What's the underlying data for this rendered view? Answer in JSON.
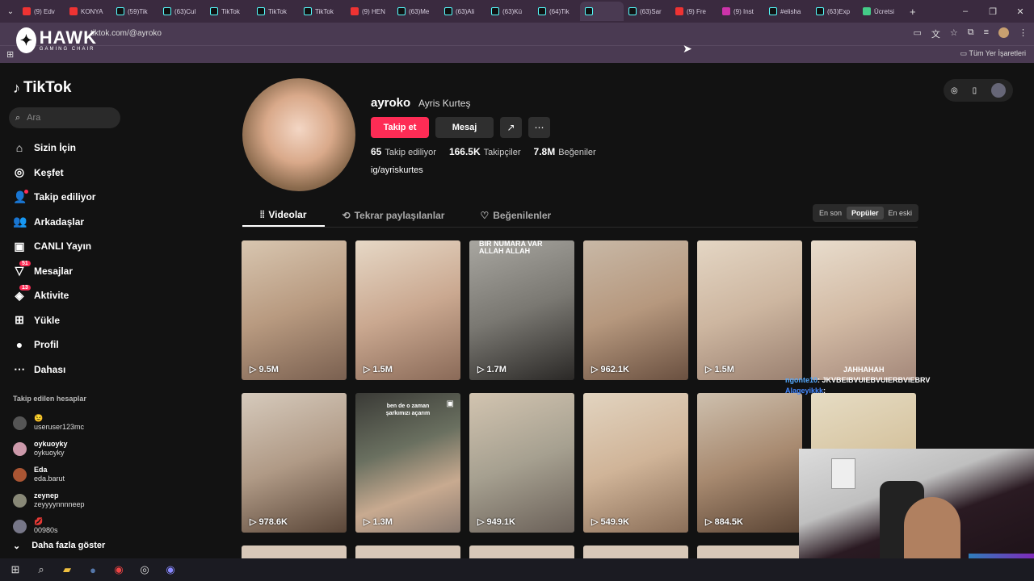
{
  "browser": {
    "tabs": [
      {
        "label": "(9) Edv",
        "fav": "yt"
      },
      {
        "label": "KONYA",
        "fav": "yt"
      },
      {
        "label": "(59)Tik",
        "fav": "tt"
      },
      {
        "label": "(63)Cul",
        "fav": "tt"
      },
      {
        "label": "TikTok",
        "fav": "tt"
      },
      {
        "label": "TikTok",
        "fav": "tt"
      },
      {
        "label": "TikTok",
        "fav": "tt"
      },
      {
        "label": "(9) HEN",
        "fav": "yt"
      },
      {
        "label": "(63)Me",
        "fav": "tt"
      },
      {
        "label": "(63)Ali",
        "fav": "tt"
      },
      {
        "label": "(63)Kü",
        "fav": "tt"
      },
      {
        "label": "(64)Tik",
        "fav": "tt"
      },
      {
        "label": "",
        "fav": "tt"
      },
      {
        "label": "(63)Sar",
        "fav": "tt"
      },
      {
        "label": "(9) Fre",
        "fav": "yt"
      },
      {
        "label": "(9) Inst",
        "fav": "ig"
      },
      {
        "label": "#elisha",
        "fav": "tt"
      },
      {
        "label": "(63)Exp",
        "fav": "tt"
      },
      {
        "label": "Ücretsi",
        "fav": "ch"
      }
    ],
    "url": "tiktok.com/@ayroko",
    "bookmarks_all": "Tüm Yer İşaretleri"
  },
  "overlay_logo": {
    "big": "HAWK",
    "small": "GAMING CHAIR"
  },
  "sidebar": {
    "logo": "TikTok",
    "search_placeholder": "Ara",
    "nav": [
      {
        "label": "Sizin İçin",
        "icon": "home-icon",
        "glyph": "⌂"
      },
      {
        "label": "Keşfet",
        "icon": "compass-icon",
        "glyph": "◎"
      },
      {
        "label": "Takip ediliyor",
        "icon": "following-icon",
        "glyph": "👤"
      },
      {
        "label": "Arkadaşlar",
        "icon": "friends-icon",
        "glyph": "👥"
      },
      {
        "label": "CANLI Yayın",
        "icon": "live-icon",
        "glyph": "▣"
      },
      {
        "label": "Mesajlar",
        "icon": "messages-icon",
        "glyph": "▽",
        "badge": "51"
      },
      {
        "label": "Aktivite",
        "icon": "activity-icon",
        "glyph": "◈",
        "badge": "13"
      },
      {
        "label": "Yükle",
        "icon": "upload-icon",
        "glyph": "⊞"
      },
      {
        "label": "Profil",
        "icon": "profile-icon",
        "glyph": "●"
      },
      {
        "label": "Dahası",
        "icon": "more-icon",
        "glyph": "⋯"
      }
    ],
    "following_title": "Takip edilen hesaplar",
    "following": [
      {
        "n1": "😉",
        "n2": "useruser123mc"
      },
      {
        "n1": "oykuoyky",
        "n2": "oykuoyky"
      },
      {
        "n1": "Eda",
        "n2": "eda.barut"
      },
      {
        "n1": "zeynep",
        "n2": "zeyyyynnnneep"
      },
      {
        "n1": "💋",
        "n2": "00980s"
      }
    ],
    "show_more": "Daha fazla göster"
  },
  "profile": {
    "username": "ayroko",
    "display_name": "Ayris Kurteş",
    "follow_btn": "Takip et",
    "message_btn": "Mesaj",
    "following_count": "65",
    "following_label": "Takip ediliyor",
    "followers_count": "166.5K",
    "followers_label": "Takipçiler",
    "likes_count": "7.8M",
    "likes_label": "Beğeniler",
    "bio": "ig/ayriskurtes"
  },
  "tabs": {
    "videos": "Videolar",
    "reposts": "Tekrar paylaşılanlar",
    "likes": "Beğenilenler"
  },
  "sort": {
    "latest": "En son",
    "popular": "Popüler",
    "oldest": "En eski"
  },
  "videos": [
    {
      "views": "9.5M"
    },
    {
      "views": "1.5M"
    },
    {
      "views": "1.7M",
      "text": "BİR NUMARA VAR ALLAH ALLAH"
    },
    {
      "views": "962.1K"
    },
    {
      "views": "1.5M"
    },
    {
      "views": ""
    },
    {
      "views": "978.6K"
    },
    {
      "views": "1.3M",
      "text": "ben de o zaman şarkımızı açarım"
    },
    {
      "views": "949.1K"
    },
    {
      "views": "549.9K"
    },
    {
      "views": "884.5K"
    },
    {
      "views": ""
    }
  ],
  "stream_chat": [
    {
      "user": "",
      "text": "JAHHAHAH",
      "cls": "u1"
    },
    {
      "user": "ngonte10",
      "text": ": JKVBEIBVUIEBVUIERBVIEBRV",
      "cls": "u2"
    },
    {
      "user": "",
      "text": "",
      "cls": "u3"
    },
    {
      "user": "Alageyikkk",
      "text": ":",
      "cls": "u4"
    },
    {
      "user": "",
      "text": "",
      "cls": "u3"
    }
  ]
}
